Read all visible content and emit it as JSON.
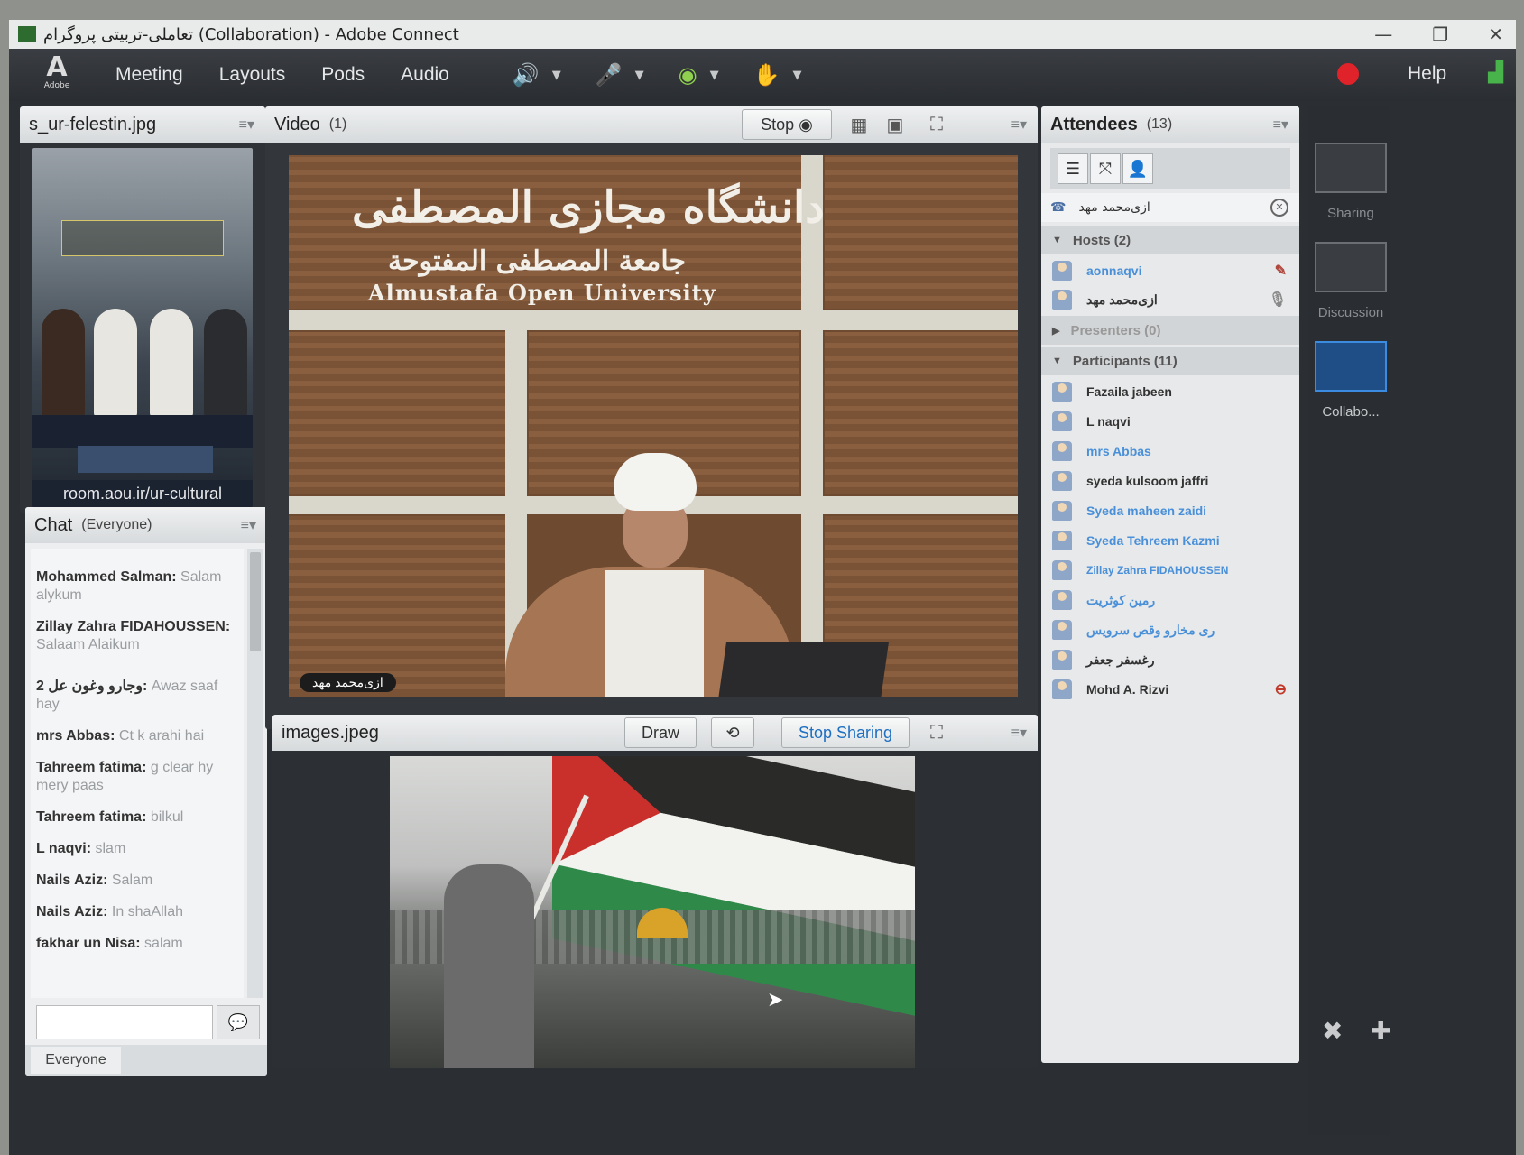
{
  "window": {
    "title": "تعاملی-تربیتی پروگرام (Collaboration) - Adobe Connect",
    "controls": [
      "—",
      "❐",
      "✕"
    ]
  },
  "menubar": {
    "logo_text": "Adobe",
    "items": [
      "Meeting",
      "Layouts",
      "Pods",
      "Audio"
    ],
    "help": "Help"
  },
  "left_image_pod": {
    "title": "s_ur-felestin.jpg",
    "caption": "room.aou.ir/ur-cultural"
  },
  "chat": {
    "title": "Chat",
    "scope": "(Everyone)",
    "messages": [
      {
        "who": "Mohammed  Salman:",
        "text": " Salam alykum"
      },
      {
        "who": "Zillay Zahra FIDAHOUSSEN:",
        "text": " Salaam Alaikum"
      },
      {
        "who": "وجارو وغون عل 2:",
        "text": " Awaz saaf hay"
      },
      {
        "who": "mrs Abbas:",
        "text": " Ct k arahi hai"
      },
      {
        "who": "Tahreem fatima:",
        "text": " g clear hy mery paas"
      },
      {
        "who": "Tahreem fatima:",
        "text": " bilkul"
      },
      {
        "who": "L naqvi:",
        "text": " slam"
      },
      {
        "who": "Nails Aziz:",
        "text": " Salam"
      },
      {
        "who": "Nails Aziz:",
        "text": " In shaAllah"
      },
      {
        "who": "fakhar un Nisa:",
        "text": " salam"
      }
    ],
    "footer_tab": "Everyone"
  },
  "video_pod": {
    "title": "Video",
    "count": "(1)",
    "stop_label": "Stop",
    "banner_ar1": "دانشگاه مجازی المصطفی",
    "banner_ar2": "جامعة المصطفى المفتوحة",
    "banner_en": "Almustafa  Open University",
    "name_tag": "ازی‌محمد مهد"
  },
  "share_pod": {
    "title": "images.jpeg",
    "draw_label": "Draw",
    "stop_sharing_label": "Stop Sharing"
  },
  "attendees": {
    "title": "Attendees",
    "count": "(13)",
    "search_value": "ازی‌محمد مهد",
    "hosts_label": "Hosts (2)",
    "hosts": [
      "aonnaqvi",
      "ازی‌محمد مهد"
    ],
    "presenters_label": "Presenters (0)",
    "participants_label": "Participants (11)",
    "participants": [
      {
        "name": "Fazaila jabeen",
        "link": false
      },
      {
        "name": "L naqvi",
        "link": false
      },
      {
        "name": "mrs Abbas",
        "link": true
      },
      {
        "name": "syeda kulsoom jaffri",
        "link": false
      },
      {
        "name": "Syeda maheen zaidi",
        "link": true
      },
      {
        "name": "Syeda Tehreem Kazmi",
        "link": true
      },
      {
        "name": "Zillay Zahra FIDAHOUSSEN",
        "link": true
      },
      {
        "name": "رمین کوثریت",
        "link": true
      },
      {
        "name": "ری مخارو وقص سرویس",
        "link": true
      },
      {
        "name": "رغسفر جعفر",
        "link": false
      },
      {
        "name": "Mohd A. Rizvi",
        "link": false
      }
    ]
  },
  "layouts": {
    "items": [
      {
        "label": "Sharing"
      },
      {
        "label": "Discussion"
      },
      {
        "label": "Collabo..."
      }
    ]
  },
  "colors": {
    "accent_blue": "#3b8be0",
    "record_red": "#e0232a",
    "audio_green": "#8fd14f"
  }
}
